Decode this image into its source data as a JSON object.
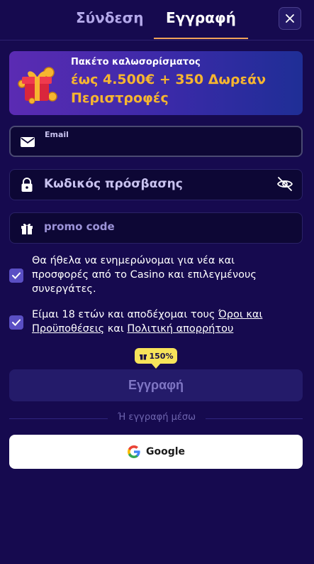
{
  "tabs": {
    "login": "Σύνδεση",
    "register": "Εγγραφή"
  },
  "banner": {
    "title": "Πακέτο καλωσορίσματος",
    "offer": "έως 4.500€ + 350 Δωρεάν Περιστροφές"
  },
  "fields": {
    "email_label": "Email",
    "email_value": "",
    "password_placeholder": "Κωδικός πρόσβασης",
    "promo_placeholder": "promo code"
  },
  "checkboxes": {
    "newsletter": "Θα ήθελα να ενημερώνομαι για νέα και προσφορές από το Casino και επιλεγμένους συνεργάτες.",
    "terms_prefix": "Είμαι 18 ετών και αποδέχομαι τους ",
    "terms_link": "Όροι και Προϋποθέσεις",
    "terms_and": " και ",
    "privacy_link": "Πολιτική απορρήτου"
  },
  "badge": "150%",
  "register_button": "Εγγραφή",
  "divider": "Ή εγγραφή μέσω",
  "google_button": "Google",
  "colors": {
    "accent_orange": "#f0a35a",
    "offer_gold": "#f6b530",
    "badge_yellow": "#f7e35a",
    "background": "#160a4f"
  }
}
